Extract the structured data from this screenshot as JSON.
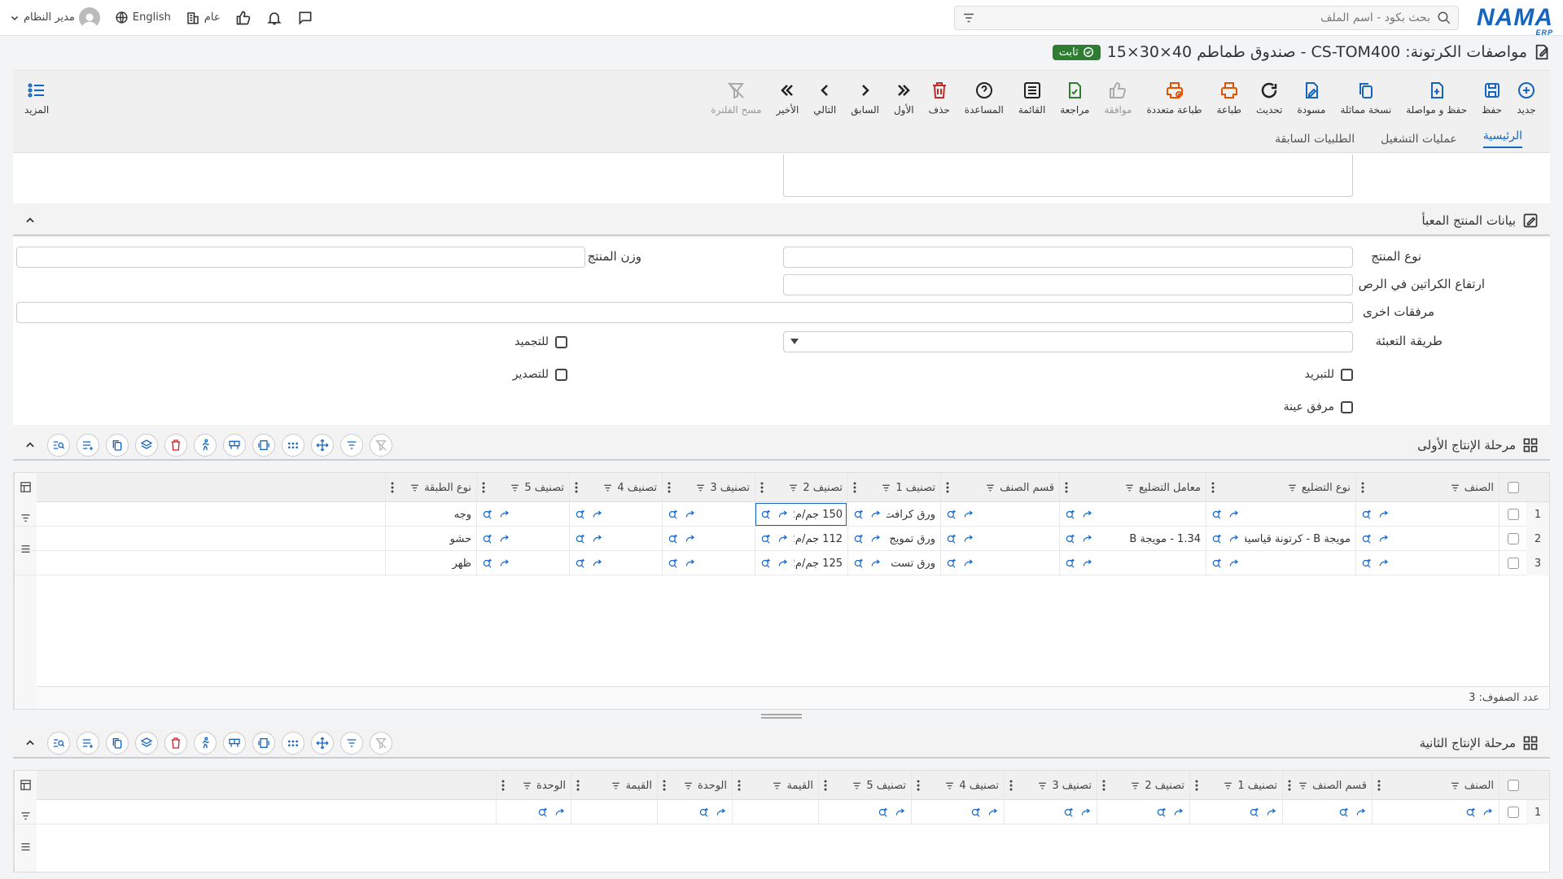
{
  "topbar": {
    "logo": "NAMA",
    "logo_sub": "ERP",
    "search_placeholder": "بحث بكود - اسم الملف",
    "language": "English",
    "branch": "عام",
    "user": "مدير النظام"
  },
  "title": {
    "text": "مواصفات الكرتونة: CS-TOM400 - صندوق طماطم 40×30×15",
    "status": "ثابت"
  },
  "toolbar": {
    "new": "جديد",
    "save": "حفظ",
    "save_continue": "حفظ و مواصلة",
    "copy": "نسخة مماثلة",
    "draft": "مسودة",
    "refresh": "تحديث",
    "print": "طباعة",
    "multi_print": "طباعة متعددة",
    "approve": "موافقة",
    "review": "مراجعة",
    "list": "القائمة",
    "help": "المساعدة",
    "delete": "حذف",
    "first": "الأول",
    "prev": "السابق",
    "next": "التالي",
    "last": "الأخير",
    "clear_filter": "مسح الفلترة",
    "more": "المزيد"
  },
  "tabs": [
    "الرئيسية",
    "عمليات التشغيل",
    "الطلبيات السابقة"
  ],
  "packed": {
    "title": "بيانات المنتج المعبأ",
    "product_type": "نوع المنتج",
    "product_weight": "وزن المنتج",
    "stack_height": "ارتفاع الكراتين في الرص",
    "other_attachments": "مرفقات اخرى",
    "packing_method": "طريقة التعبئة",
    "freezing": "للتجميد",
    "cooling": "للتبريد",
    "export": "للتصدير",
    "sample": "مرفق عينة"
  },
  "stage1": {
    "title": "مرحلة الإنتاج الأولى",
    "columns": [
      "الصنف",
      "نوع التضليع",
      "معامل التضليع",
      "قسم الصنف",
      "تصنيف 1",
      "تصنيف 2",
      "تصنيف 3",
      "تصنيف 4",
      "تصنيف 5",
      "نوع الطبقة"
    ],
    "rows": [
      {
        "n": "1",
        "c": [
          "",
          "",
          "",
          "",
          "ورق كرافت لا",
          "150 جم/م2",
          "",
          "",
          "",
          "وجه"
        ]
      },
      {
        "n": "2",
        "c": [
          "",
          "مويجة B - كرتونة قياسية",
          "1.34 - مويجة B",
          "",
          "ورق تمويج",
          "112 جم/م2",
          "",
          "",
          "",
          "حشو"
        ]
      },
      {
        "n": "3",
        "c": [
          "",
          "",
          "",
          "",
          "ورق تست لاين",
          "125 جم/م2",
          "",
          "",
          "",
          "ظهر"
        ]
      }
    ],
    "footer": "عدد الصفوف: 3"
  },
  "stage2": {
    "title": "مرحلة الإنتاج الثانية",
    "columns": [
      "الصنف",
      "قسم الصنف",
      "تصنيف 1",
      "تصنيف 2",
      "تصنيف 3",
      "تصنيف 4",
      "تصنيف 5",
      "القيمة",
      "الوحدة",
      "القيمة",
      "الوحدة"
    ],
    "rows": [
      {
        "n": "1"
      }
    ]
  }
}
